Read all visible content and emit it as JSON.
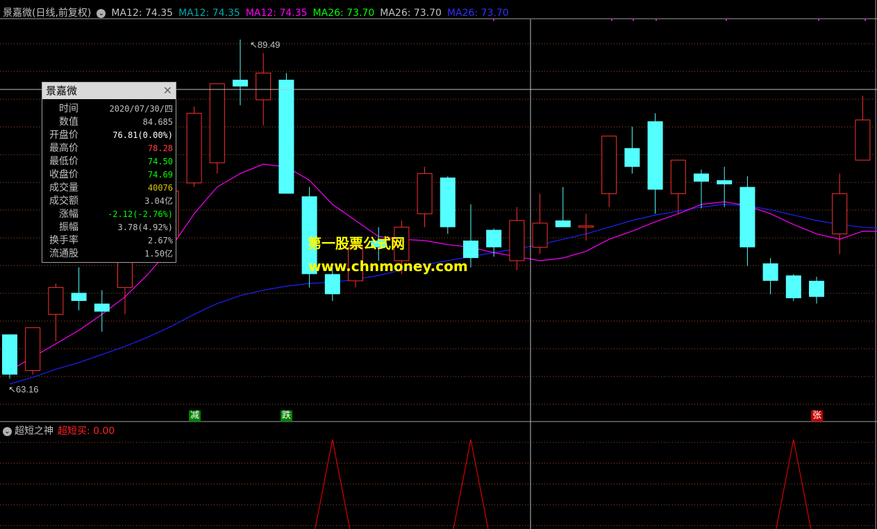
{
  "legend": {
    "name": "景嘉微(日线,前复权)",
    "ma_items": [
      {
        "text": "MA12: 74.35",
        "color": "#c0c0c0"
      },
      {
        "text": "MA12: 74.35",
        "color": "#00a8a8"
      },
      {
        "text": "MA12: 74.35",
        "color": "#ff00ff"
      },
      {
        "text": "MA26: 73.70",
        "color": "#00ff00"
      },
      {
        "text": "MA26: 73.70",
        "color": "#c0c0c0"
      },
      {
        "text": "MA26: 73.70",
        "color": "#3030ff"
      }
    ]
  },
  "sub_legend": {
    "name": "超短之神",
    "indicator": "超短买: 0.00"
  },
  "infobox": {
    "title": "景嘉微",
    "close_icon": "close-icon",
    "rows": [
      {
        "k": "时间",
        "v": "2020/07/30/四",
        "color": "#c0c0c0"
      },
      {
        "k": "数值",
        "v": "84.685",
        "color": "#c0c0c0"
      },
      {
        "k": "开盘价",
        "v": "76.81(0.00%)",
        "color": "#ffffff"
      },
      {
        "k": "最高价",
        "v": "78.28",
        "color": "#ff4040"
      },
      {
        "k": "最低价",
        "v": "74.50",
        "color": "#00ff00"
      },
      {
        "k": "收盘价",
        "v": "74.69",
        "color": "#00ff00"
      },
      {
        "k": "成交量",
        "v": "40076",
        "color": "#d8c800"
      },
      {
        "k": "成交额",
        "v": "3.04亿",
        "color": "#c0c0c0"
      },
      {
        "k": "涨幅",
        "v": "-2.12(-2.76%)",
        "color": "#00ff00"
      },
      {
        "k": "振幅",
        "v": "3.78(4.92%)",
        "color": "#c0c0c0"
      },
      {
        "k": "换手率",
        "v": "2.67%",
        "color": "#c0c0c0"
      },
      {
        "k": "流通股",
        "v": "1.50亿",
        "color": "#c0c0c0"
      }
    ]
  },
  "annotations": {
    "high_label": "89.49",
    "low_label": "63.16",
    "marker_jian": "减",
    "marker_die": "跌",
    "marker_zhang": "张"
  },
  "watermark": {
    "line1": "第一股票公式网",
    "line2": "www.chnmoney.com"
  },
  "colors": {
    "up": "#ff3030",
    "down": "#54ffff",
    "ma12": "#ff00ff",
    "ma26": "#2020ff",
    "grid": "#a05020",
    "signal": "#ff0000"
  },
  "chart_data": {
    "type": "candlestick",
    "price_range": [
      61.0,
      91.0
    ],
    "candles": [
      {
        "o": 67.5,
        "h": 67.5,
        "l": 64.2,
        "c": 64.5
      },
      {
        "o": 64.8,
        "h": 68.0,
        "l": 64.5,
        "c": 68.0
      },
      {
        "o": 69.0,
        "h": 71.3,
        "l": 67.0,
        "c": 71.0
      },
      {
        "o": 70.6,
        "h": 72.5,
        "l": 69.3,
        "c": 70.0
      },
      {
        "o": 69.8,
        "h": 70.8,
        "l": 67.7,
        "c": 69.2
      },
      {
        "o": 71.0,
        "h": 74.5,
        "l": 69.0,
        "c": 74.0
      },
      {
        "o": 74.5,
        "h": 76.5,
        "l": 73.5,
        "c": 76.0
      },
      {
        "o": 74.7,
        "h": 78.3,
        "l": 74.5,
        "c": 78.2
      },
      {
        "o": 78.8,
        "h": 84.5,
        "l": 78.5,
        "c": 84.0
      },
      {
        "o": 80.3,
        "h": 86.2,
        "l": 79.5,
        "c": 86.2
      },
      {
        "o": 86.5,
        "h": 89.5,
        "l": 84.6,
        "c": 86.0
      },
      {
        "o": 85.0,
        "h": 88.5,
        "l": 83.1,
        "c": 87.0
      },
      {
        "o": 86.5,
        "h": 87.0,
        "l": 78.0,
        "c": 78.0
      },
      {
        "o": 77.8,
        "h": 78.5,
        "l": 71.0,
        "c": 72.0
      },
      {
        "o": 72.0,
        "h": 72.5,
        "l": 70.0,
        "c": 70.5
      },
      {
        "o": 71.5,
        "h": 74.5,
        "l": 71.0,
        "c": 74.0
      },
      {
        "o": 74.5,
        "h": 75.5,
        "l": 73.0,
        "c": 74.0
      },
      {
        "o": 73.0,
        "h": 76.0,
        "l": 72.0,
        "c": 75.5
      },
      {
        "o": 76.5,
        "h": 80.0,
        "l": 75.5,
        "c": 79.5
      },
      {
        "o": 79.2,
        "h": 79.3,
        "l": 75.0,
        "c": 75.5
      },
      {
        "o": 74.5,
        "h": 77.2,
        "l": 72.5,
        "c": 73.2
      },
      {
        "o": 75.3,
        "h": 75.4,
        "l": 73.3,
        "c": 74.0
      },
      {
        "o": 73.0,
        "h": 77.0,
        "l": 72.3,
        "c": 76.0
      },
      {
        "o": 74.0,
        "h": 78.0,
        "l": 73.5,
        "c": 75.8
      },
      {
        "o": 76.0,
        "h": 78.5,
        "l": 75.5,
        "c": 75.5
      },
      {
        "o": 75.5,
        "h": 76.5,
        "l": 74.5,
        "c": 75.6
      },
      {
        "o": 78.0,
        "h": 81.5,
        "l": 77.0,
        "c": 82.3
      },
      {
        "o": 81.4,
        "h": 83.0,
        "l": 79.5,
        "c": 80.0
      },
      {
        "o": 83.4,
        "h": 84.0,
        "l": 76.5,
        "c": 78.3
      },
      {
        "o": 78.0,
        "h": 79.5,
        "l": 76.5,
        "c": 80.5
      },
      {
        "o": 79.5,
        "h": 79.8,
        "l": 76.9,
        "c": 78.9
      },
      {
        "o": 79.0,
        "h": 80.0,
        "l": 77.0,
        "c": 78.7
      },
      {
        "o": 78.5,
        "h": 79.3,
        "l": 72.6,
        "c": 74.0
      },
      {
        "o": 72.8,
        "h": 73.2,
        "l": 70.5,
        "c": 71.5
      },
      {
        "o": 71.9,
        "h": 72.0,
        "l": 70.0,
        "c": 70.2
      },
      {
        "o": 71.5,
        "h": 71.8,
        "l": 69.8,
        "c": 70.3
      },
      {
        "o": 75.0,
        "h": 79.5,
        "l": 73.5,
        "c": 78.0
      },
      {
        "o": 80.5,
        "h": 85.3,
        "l": 80.5,
        "c": 83.5
      },
      {
        "o": 83.5,
        "h": 85.5,
        "l": 82.0,
        "c": 82.2
      }
    ],
    "ma12": [
      64.8,
      65.8,
      66.8,
      67.8,
      69.0,
      70.3,
      72.0,
      74.0,
      76.5,
      78.5,
      79.5,
      80.2,
      80.0,
      79.0,
      77.2,
      76.0,
      74.8,
      74.6,
      74.5,
      74.2,
      74.0,
      73.6,
      73.3,
      73.0,
      73.2,
      73.7,
      74.6,
      75.2,
      75.9,
      76.5,
      77.2,
      77.4,
      77.1,
      76.5,
      75.7,
      75.0,
      74.6,
      75.2,
      75.2
    ],
    "ma26": [
      63.8,
      64.3,
      64.9,
      65.4,
      66.0,
      66.6,
      67.3,
      68.1,
      69.0,
      69.8,
      70.4,
      70.8,
      71.1,
      71.3,
      71.4,
      71.6,
      71.9,
      72.3,
      72.7,
      73.0,
      73.3,
      73.6,
      73.9,
      74.2,
      74.6,
      75.0,
      75.5,
      76.0,
      76.4,
      76.7,
      77.0,
      77.2,
      77.1,
      76.8,
      76.4,
      76.0,
      75.7,
      75.5,
      75.4
    ],
    "signals": [
      14,
      20,
      34
    ]
  }
}
